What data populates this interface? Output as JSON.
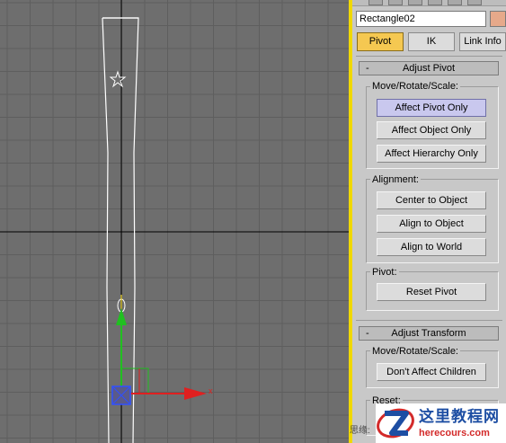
{
  "object_name": "Rectangle02",
  "colors": {
    "object_color": "#e6a98a",
    "active_tab": "#f5c851",
    "active_button": "#c9c8ee",
    "viewport_bg": "#6e6e6e",
    "active_viewport_border": "#f0d800"
  },
  "tabs": [
    {
      "label": "Pivot",
      "active": true
    },
    {
      "label": "IK",
      "active": false
    },
    {
      "label": "Link Info",
      "active": false
    }
  ],
  "adjust_pivot": {
    "collapse_symbol": "-",
    "title": "Adjust Pivot",
    "move_group_label": "Move/Rotate/Scale:",
    "move_buttons": [
      "Affect Pivot Only",
      "Affect Object Only",
      "Affect Hierarchy Only"
    ],
    "alignment_label": "Alignment:",
    "alignment_buttons": [
      "Center to Object",
      "Align to Object",
      "Align to World"
    ],
    "pivot_label": "Pivot:",
    "reset_pivot": "Reset Pivot"
  },
  "adjust_transform": {
    "collapse_symbol": "-",
    "title": "Adjust Transform",
    "move_group_label": "Move/Rotate/Scale:",
    "dont_affect_children": "Don't Affect Children",
    "reset_label": "Reset:"
  },
  "gizmo": {
    "x_axis_label": "x",
    "x_axis_color": "#e02020",
    "y_axis_color": "#20c020",
    "z_axis_color": "#3050ff"
  },
  "watermark": {
    "side_text": "思缘:",
    "site_name": "这里教程网",
    "site_url": "herecours.com"
  }
}
